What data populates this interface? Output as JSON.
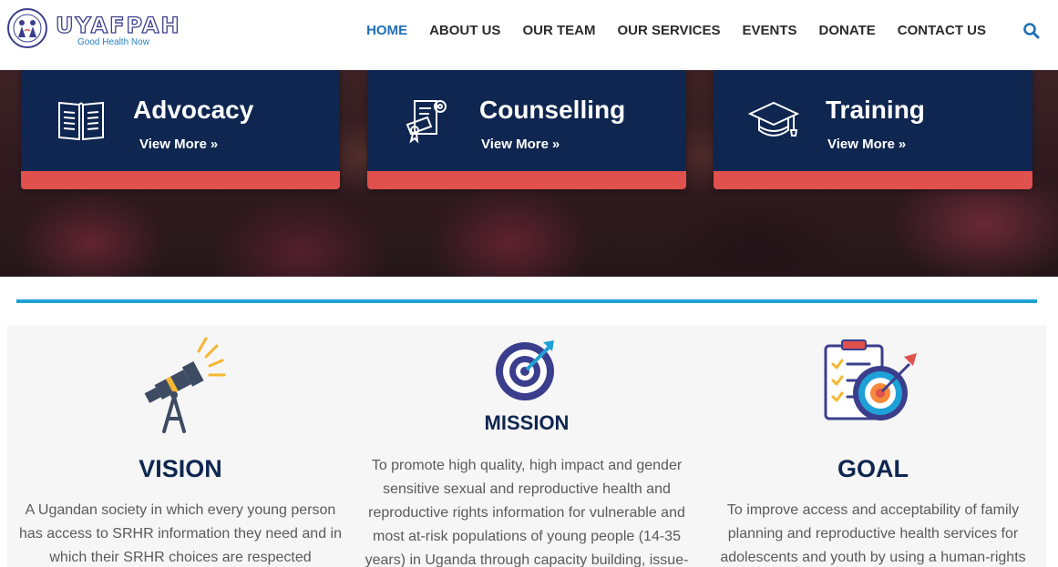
{
  "brand": {
    "name": "UYAFPAH",
    "tagline": "Good Health Now",
    "seal_text": "UYAFPAH"
  },
  "nav": {
    "items": [
      {
        "label": "HOME",
        "active": true
      },
      {
        "label": "ABOUT US",
        "active": false
      },
      {
        "label": "OUR TEAM",
        "active": false
      },
      {
        "label": "OUR SERVICES",
        "active": false
      },
      {
        "label": "EVENTS",
        "active": false
      },
      {
        "label": "DONATE",
        "active": false
      },
      {
        "label": "CONTACT US",
        "active": false
      }
    ],
    "search_icon": "search-icon"
  },
  "services": [
    {
      "title": "Advocacy",
      "link": "View More",
      "icon": "open-book-icon"
    },
    {
      "title": "Counselling",
      "link": "View More",
      "icon": "certificate-gear-icon"
    },
    {
      "title": "Training",
      "link": "View More",
      "icon": "graduation-cap-icon"
    }
  ],
  "vmg": {
    "vision": {
      "title": "VISION",
      "text": "A Ugandan society in which every young person has access to SRHR information they need and in which their SRHR choices are respected",
      "icon": "telescope-icon"
    },
    "mission": {
      "title": "MISSION",
      "text": "To promote high quality, high impact and gender sensitive sexual and reproductive health and reproductive rights information for vulnerable and most at-risk populations of young people (14-35 years) in Uganda through capacity building, issue-",
      "icon": "target-arrow-icon"
    },
    "goal": {
      "title": "GOAL",
      "text": "To improve access and acceptability of family planning and reproductive health services for adolescents and youth by using a human-rights",
      "icon": "checklist-target-icon"
    }
  },
  "colors": {
    "navy": "#0e2650",
    "accent_red": "#e0504c",
    "nav_active": "#1f6fb5",
    "divider": "#1ea1d6"
  }
}
